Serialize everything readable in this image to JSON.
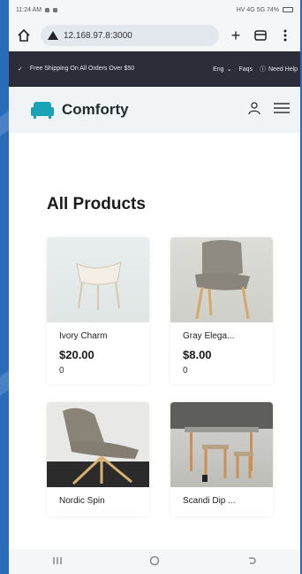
{
  "status": {
    "time": "11:24 AM",
    "right": "HV 4G 5G 74%"
  },
  "browser": {
    "url": "12.168.97.8:3000"
  },
  "promo": {
    "shipping_text": "Free Shipping On All Orders Over $50",
    "language": "Eng",
    "faqs": "Faqs",
    "help": "Need Help"
  },
  "header": {
    "brand": "Comforty"
  },
  "main": {
    "title": "All Products",
    "products": [
      {
        "name": "Ivory Charm",
        "price": "$20.00",
        "count": "0"
      },
      {
        "name": "Gray Elega...",
        "price": "$8.00",
        "count": "0"
      },
      {
        "name": "Nordic Spin",
        "price": "",
        "count": ""
      },
      {
        "name": "Scandi Dip ...",
        "price": "",
        "count": ""
      }
    ]
  },
  "colors": {
    "promo_bg": "#2d2d3a",
    "brand_teal": "#1aa3b5",
    "header_bg": "#f1f4f6"
  }
}
